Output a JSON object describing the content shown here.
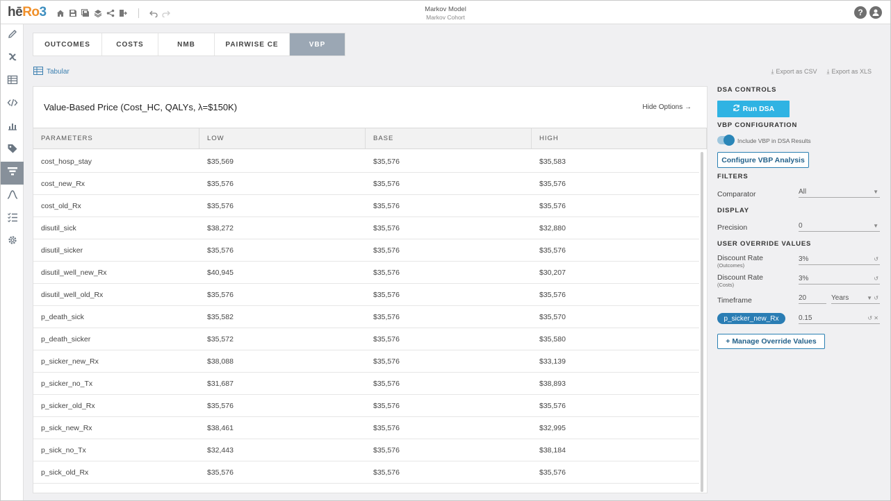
{
  "app": {
    "logo_h": "hē",
    "logo_r": "Ro",
    "logo_3": "3",
    "title": "Markov Model",
    "subtitle": "Markov Cohort"
  },
  "toolbar_icons": [
    "home-icon",
    "save-icon",
    "save-as-icon",
    "layers-icon",
    "share-icon",
    "export-icon",
    "undo-icon",
    "redo-icon"
  ],
  "header_right": {
    "help": "?",
    "user": "account-icon"
  },
  "rail_icons": [
    "pencil-icon",
    "variable-icon",
    "table-icon",
    "code-icon",
    "bar-chart-icon",
    "tag-icon",
    "filter-icon",
    "curve-icon",
    "checklist-icon",
    "gear-icon"
  ],
  "rail_active": 6,
  "tabs": [
    {
      "label": "OUTCOMES"
    },
    {
      "label": "COSTS"
    },
    {
      "label": "NMB"
    },
    {
      "label": "PAIRWISE CE"
    },
    {
      "label": "VBP"
    }
  ],
  "active_tab": 4,
  "view": {
    "tabular_label": "Tabular"
  },
  "exports": {
    "csv": "Export as CSV",
    "xls": "Export as XLS"
  },
  "table": {
    "title": "Value-Based Price (Cost_HC, QALYs, λ=$150K)",
    "hide_options": "Hide Options →",
    "headers": [
      "PARAMETERS",
      "LOW",
      "BASE",
      "HIGH"
    ],
    "rows": [
      [
        "cost_hosp_stay",
        "$35,569",
        "$35,576",
        "$35,583"
      ],
      [
        "cost_new_Rx",
        "$35,576",
        "$35,576",
        "$35,576"
      ],
      [
        "cost_old_Rx",
        "$35,576",
        "$35,576",
        "$35,576"
      ],
      [
        "disutil_sick",
        "$38,272",
        "$35,576",
        "$32,880"
      ],
      [
        "disutil_sicker",
        "$35,576",
        "$35,576",
        "$35,576"
      ],
      [
        "disutil_well_new_Rx",
        "$40,945",
        "$35,576",
        "$30,207"
      ],
      [
        "disutil_well_old_Rx",
        "$35,576",
        "$35,576",
        "$35,576"
      ],
      [
        "p_death_sick",
        "$35,582",
        "$35,576",
        "$35,570"
      ],
      [
        "p_death_sicker",
        "$35,572",
        "$35,576",
        "$35,580"
      ],
      [
        "p_sicker_new_Rx",
        "$38,088",
        "$35,576",
        "$33,139"
      ],
      [
        "p_sicker_no_Tx",
        "$31,687",
        "$35,576",
        "$38,893"
      ],
      [
        "p_sicker_old_Rx",
        "$35,576",
        "$35,576",
        "$35,576"
      ],
      [
        "p_sick_new_Rx",
        "$38,461",
        "$35,576",
        "$32,995"
      ],
      [
        "p_sick_no_Tx",
        "$32,443",
        "$35,576",
        "$38,184"
      ],
      [
        "p_sick_old_Rx",
        "$35,576",
        "$35,576",
        "$35,576"
      ]
    ]
  },
  "panel": {
    "dsa_controls": "DSA CONTROLS",
    "run_dsa": "Run DSA",
    "vbp_configuration": "VBP CONFIGURATION",
    "include_vbp": "Include VBP in DSA Results",
    "include_vbp_on": true,
    "configure_vbp": "Configure VBP Analysis",
    "filters": "FILTERS",
    "comparator_label": "Comparator",
    "comparator_value": "All",
    "display": "DISPLAY",
    "precision_label": "Precision",
    "precision_value": "0",
    "user_override": "USER OVERRIDE VALUES",
    "discount_label": "Discount Rate",
    "discount_outcomes_sub": "(Outcomes)",
    "discount_outcomes_value": "3%",
    "discount_costs_sub": "(Costs)",
    "discount_costs_value": "3%",
    "timeframe_label": "Timeframe",
    "timeframe_value": "20",
    "timeframe_unit": "Years",
    "param_chip": "p_sicker_new_Rx",
    "param_value": "0.15",
    "manage_override": "+ Manage Override Values"
  },
  "colors": {
    "accent": "#2fb3e3",
    "active_tab": "#9ba7b4",
    "chip": "#2a7db4",
    "rail_active": "#87909a"
  }
}
